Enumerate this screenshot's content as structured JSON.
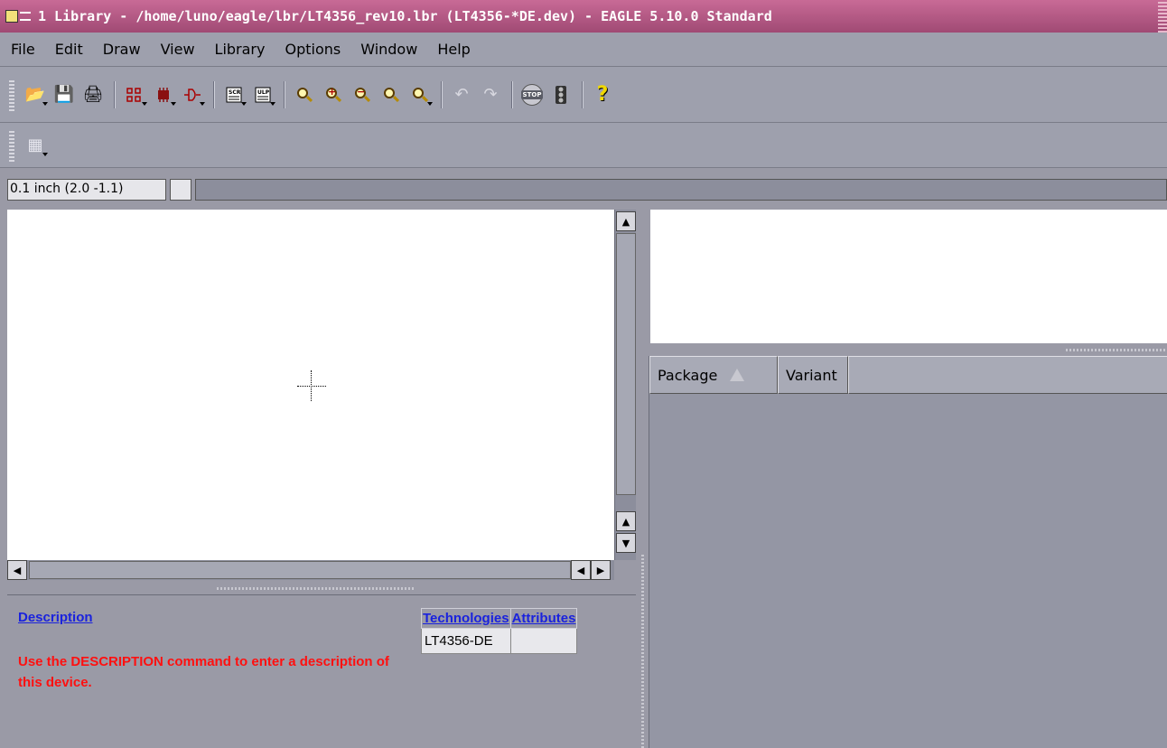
{
  "window": {
    "title": "1 Library - /home/luno/eagle/lbr/LT4356_rev10.lbr (LT4356-*DE.dev) - EAGLE 5.10.0 Standard"
  },
  "menu": {
    "items": [
      "File",
      "Edit",
      "Draw",
      "View",
      "Library",
      "Options",
      "Window",
      "Help"
    ]
  },
  "toolbar": {
    "open_icon": "📂",
    "save_icon": "💾",
    "print_icon": "🖨",
    "stop_label": "STOP",
    "help_label": "?",
    "zoom_in_symbol": "+",
    "zoom_out_symbol": "−",
    "undo_icon": "↶",
    "redo_icon": "↷",
    "grid_icon": "▦"
  },
  "status": {
    "coordinates": "0.1 inch (2.0 -1.1)"
  },
  "description": {
    "title": "Description",
    "body": "Use the DESCRIPTION command to enter a description of this device."
  },
  "technologies": {
    "headers": [
      "Technologies",
      "Attributes"
    ],
    "rows": [
      [
        "LT4356-DE",
        ""
      ]
    ]
  },
  "packages": {
    "headers": [
      "Package",
      "Variant"
    ]
  },
  "colors": {
    "title_bar": "#b45a84",
    "link_blue": "#1a22dd",
    "warning_red": "#ff1010",
    "panel_gray": "#9a9aa6"
  }
}
